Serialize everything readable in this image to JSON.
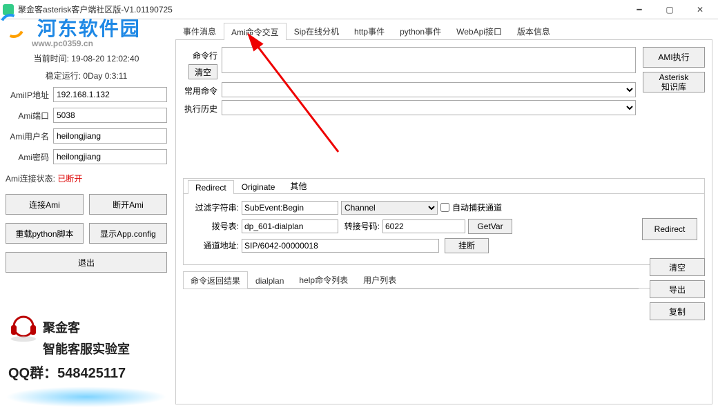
{
  "window": {
    "title": "聚金客asterisk客户端社区版-V1.01190725"
  },
  "watermark": {
    "text": "河东软件园",
    "url": "www.pc0359.cn"
  },
  "left": {
    "current_time_label": "当前时间:",
    "current_time_value": "19-08-20    12:02:40",
    "uptime_label": "稳定运行:",
    "uptime_value": "0Day 0:3:11",
    "fields": {
      "amiip_label": "AmiIP地址",
      "amiip_value": "192.168.1.132",
      "amiport_label": "Ami端口",
      "amiport_value": "5038",
      "amiuser_label": "Ami用户名",
      "amiuser_value": "heilongjiang",
      "amipass_label": "Ami密码",
      "amipass_value": "heilongjiang"
    },
    "conn_status_label": "Ami连接状态:",
    "conn_status_value": "已断开",
    "buttons": {
      "connect": "连接Ami",
      "disconnect": "断开Ami",
      "reload_py": "重载python脚本",
      "show_config": "显示App.config",
      "exit": "退出"
    },
    "logo": {
      "brand1": "聚金客",
      "brand2": "智能客服实验室",
      "qq_label": "QQ群：",
      "qq_number": "548425117"
    }
  },
  "right": {
    "tabs": [
      "事件消息",
      "Ami命令交互",
      "Sip在线分机",
      "http事件",
      "python事件",
      "WebApi接口",
      "版本信息"
    ],
    "active_tab": 1,
    "cmd_label": "命令行",
    "clear_btn": "清空",
    "common_cmd_label": "常用命令",
    "history_label": "执行历史",
    "btn_ami_exec": "AMI执行",
    "btn_kb": "Asterisk\n知识库",
    "inner_tabs": [
      "Redirect",
      "Originate",
      "其他"
    ],
    "inner_active": 0,
    "filter_label": "过滤字符串:",
    "filter_value": "SubEvent:Begin",
    "channel_select": "Channel",
    "auto_capture_label": "自动捕获通道",
    "dial_table_label": "拨号表:",
    "dial_table_value": "dp_601-dialplan",
    "transfer_label": "转接号码:",
    "transfer_value": "6022",
    "getvar_btn": "GetVar",
    "channel_addr_label": "通道地址:",
    "channel_addr_value": "SIP/6042-00000018",
    "hangup_btn": "挂断",
    "redirect_btn": "Redirect",
    "result_tabs": [
      "命令返回结果",
      "dialplan",
      "help命令列表",
      "用户列表"
    ],
    "result_active": 0,
    "result_btns": {
      "clear": "清空",
      "export": "导出",
      "copy": "复制"
    }
  }
}
